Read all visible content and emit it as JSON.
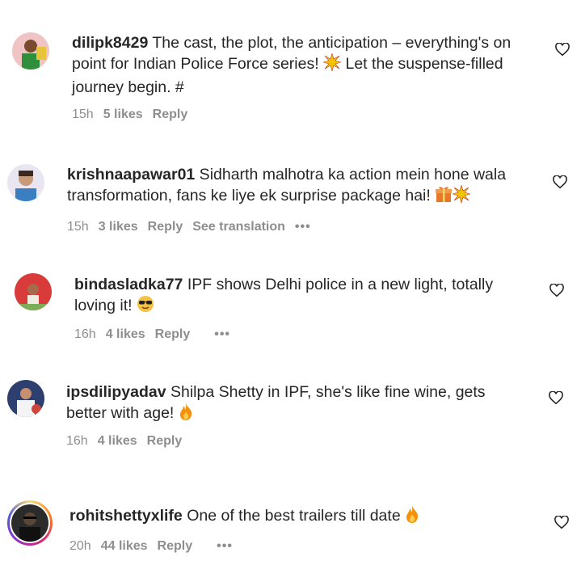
{
  "comments": [
    {
      "username": "dilipk8429",
      "text_line1": " The cast, the plot, the anticipation – everything's on",
      "text_line2": "point for Indian Police Force series! ",
      "text_line2b": " Let the suspense-filled",
      "text_line3": "journey begin. #",
      "time": "15h",
      "likes": "5 likes",
      "reply": "Reply",
      "emojis": [
        "sparkle-burst"
      ]
    },
    {
      "username": "krishnaapawar01",
      "text_line1": " Sidharth malhotra ka action mein hone wala",
      "text_line2": "transformation, fans ke liye ek surprise package hai! ",
      "time": "15h",
      "likes": "3 likes",
      "reply": "Reply",
      "translation": "See translation",
      "more": "•••",
      "emojis": [
        "gift",
        "sparkle-burst"
      ]
    },
    {
      "username": "bindasladka77",
      "text_line1": " IPF shows Delhi police in a new light, totally",
      "text_line2": "loving it! ",
      "time": "16h",
      "likes": "4 likes",
      "reply": "Reply",
      "more": "•••",
      "emojis": [
        "sunglasses-face"
      ]
    },
    {
      "username": "ipsdilipyadav",
      "text_line1": " Shilpa Shetty in IPF, she's like fine wine, gets",
      "text_line2": "better with age! ",
      "time": "16h",
      "likes": "4 likes",
      "reply": "Reply",
      "emojis": [
        "fire"
      ]
    },
    {
      "username": "rohitshettyxlife",
      "text_line1": " One of the best trailers till date ",
      "time": "20h",
      "likes": "44 likes",
      "reply": "Reply",
      "more": "•••",
      "emojis": [
        "fire"
      ]
    }
  ],
  "partial_next": "",
  "colors": {
    "text": "#262626",
    "meta": "#8e8e8e",
    "fire": "#f4900c",
    "gift": "#e8792b",
    "sparkle": "#f2c500"
  },
  "icons": {
    "like": "heart-outline-icon"
  }
}
